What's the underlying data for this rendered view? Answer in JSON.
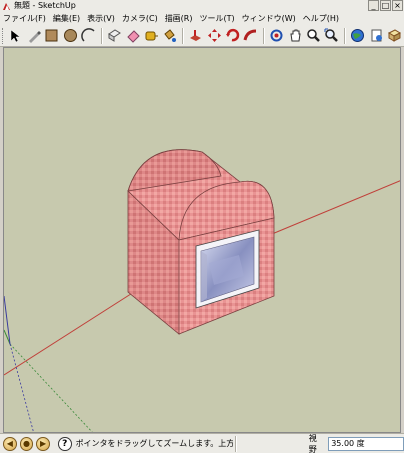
{
  "window": {
    "title": "無題 - SketchUp"
  },
  "menu": [
    "ファイル(F)",
    "編集(E)",
    "表示(V)",
    "カメラ(C)",
    "描画(R)",
    "ツール(T)",
    "ウィンドウ(W)",
    "ヘルプ(H)"
  ],
  "toolbar": {
    "tools": [
      "select-tool",
      "pencil-tool",
      "rectangle-tool",
      "circle-tool",
      "arc-tool",
      "make-component-tool",
      "eraser-tool",
      "tape-measure-tool",
      "paint-bucket-tool",
      "push-pull-tool",
      "move-tool",
      "rotate-tool",
      "follow-me-tool",
      "offset-tool",
      "orbit-tool",
      "pan-tool",
      "zoom-tool",
      "zoom-extents-tool",
      "previous-view-tool",
      "get-models-tool",
      "share-model-tool"
    ]
  },
  "viewport": {
    "background_color": "#c7c9ae",
    "red_axis_color": "#c0403a",
    "green_axis_color": "#3a8a3a",
    "blue_axis_color": "#3a3aa0",
    "model_color": "#e89494",
    "model_description_hidden": true
  },
  "status": {
    "hint": "ポインタをドラッグしてズームします。上方向はズ",
    "vcb_label": "視野",
    "vcb_value": "35.00 度"
  }
}
